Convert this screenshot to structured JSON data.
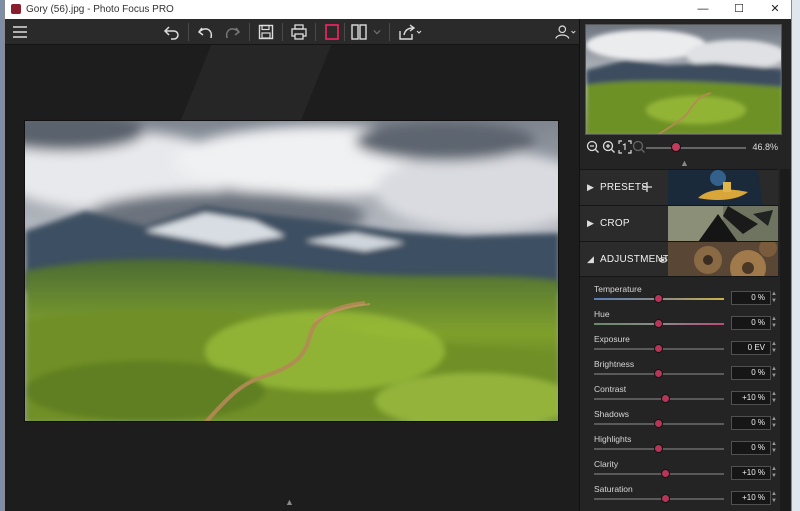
{
  "window": {
    "title": "Gory (56).jpg - Photo Focus PRO",
    "minimize_glyph": "—",
    "maximize_glyph": "☐",
    "close_glyph": "✕"
  },
  "toolbar": {
    "icons": [
      "menu-icon",
      "undo-all-icon",
      "undo-icon",
      "redo-icon",
      "save-icon",
      "print-icon",
      "single-view-icon",
      "split-view-icon",
      "split-view-dropdown-icon",
      "share-icon",
      "user-account-icon"
    ],
    "accent_color": "#e0245e"
  },
  "navigator": {
    "zoom_value": "46.8%",
    "zoom_level_fraction": 0.3
  },
  "sections": {
    "presets": {
      "label": "PRESETS",
      "arrow": "▶"
    },
    "crop": {
      "label": "CROP",
      "arrow": "▶"
    },
    "adjustments": {
      "label": "ADJUSTMENTS",
      "arrow": "◢"
    }
  },
  "adjustments": [
    {
      "name": "Temperature",
      "value": "0 %",
      "position": 0.5,
      "track": "temperature"
    },
    {
      "name": "Hue",
      "value": "0 %",
      "position": 0.5,
      "track": "hue"
    },
    {
      "name": "Exposure",
      "value": "0 EV",
      "position": 0.5,
      "track": "plain"
    },
    {
      "name": "Brightness",
      "value": "0 %",
      "position": 0.5,
      "track": "plain"
    },
    {
      "name": "Contrast",
      "value": "+10 %",
      "position": 0.55,
      "track": "plain"
    },
    {
      "name": "Shadows",
      "value": "0 %",
      "position": 0.5,
      "track": "plain"
    },
    {
      "name": "Highlights",
      "value": "0 %",
      "position": 0.5,
      "track": "plain"
    },
    {
      "name": "Clarity",
      "value": "+10 %",
      "position": 0.55,
      "track": "plain"
    },
    {
      "name": "Saturation",
      "value": "+10 %",
      "position": 0.55,
      "track": "plain"
    }
  ]
}
